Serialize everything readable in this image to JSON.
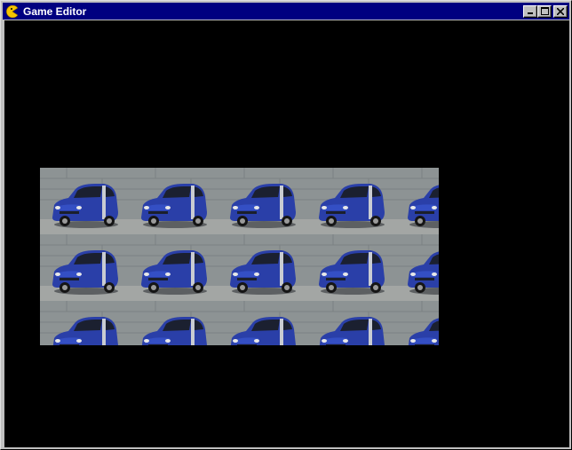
{
  "window": {
    "title": "Game Editor",
    "icon": "pacman-app-icon",
    "controls": [
      "minimize-icon",
      "maximize-icon",
      "close-icon"
    ]
  },
  "canvas": {
    "background": "#000000",
    "tile_image": "blue-smart-car",
    "tile_grid": {
      "columns": 5,
      "rows": 3
    }
  },
  "colors": {
    "titlebar": "#000080",
    "car_body": "#2a3fa8",
    "wall": "#8d9394"
  }
}
